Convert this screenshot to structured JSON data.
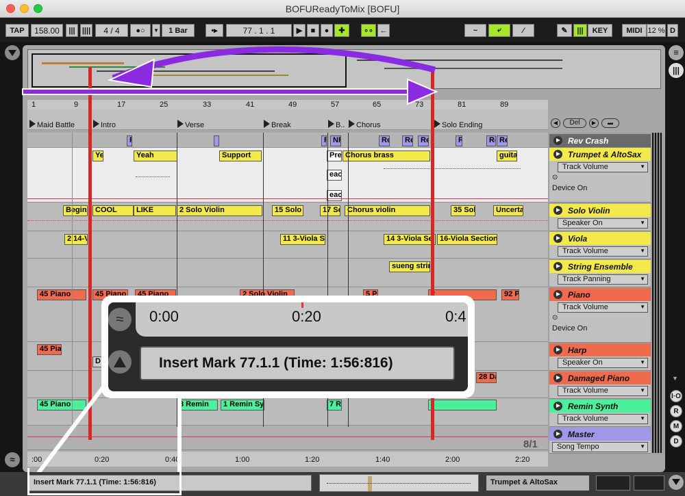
{
  "window": {
    "title": "BOFUReadyToMix  [BOFU]"
  },
  "control_bar": {
    "tap": "TAP",
    "tempo": "158.00",
    "signature": "4 / 4",
    "quantize": "1 Bar",
    "position": "77 .   1 .   1",
    "key": "KEY",
    "midi": "MIDI",
    "cpu": "12 %",
    "d": "D"
  },
  "ruler": {
    "bars": [
      "1",
      "9",
      "17",
      "25",
      "33",
      "41",
      "49",
      "57",
      "65",
      "73",
      "81",
      "89"
    ]
  },
  "locators": [
    "Maid Battle",
    "Intro",
    "Verse",
    "Break",
    "B..",
    "Chorus",
    "Solo Ending"
  ],
  "locator_controls": {
    "del": "Del"
  },
  "clips": {
    "rev": [
      "R",
      "R",
      "NR",
      "Re",
      "Re",
      "Re",
      "R",
      "Re",
      "Re"
    ],
    "lyrics": [
      "Ye",
      "Yeah",
      "Support",
      "Pre",
      "Chorus brass",
      "guita",
      "eact",
      "eact"
    ],
    "solo_violin": [
      "Begin",
      "COOL",
      "LIKE",
      "2 Solo Violin",
      "15 Solo",
      "17 So",
      "Chorus violin",
      "35 Sol",
      "Uncerta"
    ],
    "viola": [
      "2 14-V",
      "11 3-Viola Sc",
      "14 3-Viola Se",
      "16-Viola Section"
    ],
    "string": [
      "sueng strin"
    ],
    "piano": [
      "45 Piano",
      "45 Piano",
      "45 Piano",
      "2 Solo Violin",
      "5 P",
      "2",
      "92 P"
    ],
    "harp": [
      "45 Pia",
      "D",
      "28 Da"
    ],
    "remin": [
      "45 Piano",
      "8 Remin",
      "1 Remin Sy",
      "7 R"
    ]
  },
  "tracks": [
    {
      "name": "Rev Crash",
      "color": "#6a6a6a"
    },
    {
      "name": "Trumpet & AltoSax",
      "color": "#f3e94a",
      "param": "Track Volume",
      "device": "Device On"
    },
    {
      "name": "Solo Violin",
      "color": "#f3e94a",
      "param": "Speaker On"
    },
    {
      "name": "Viola",
      "color": "#f3e94a",
      "param": "Track Volume"
    },
    {
      "name": "String Ensemble",
      "color": "#f3e94a",
      "param": "Track Panning"
    },
    {
      "name": "Piano",
      "color": "#f06a4e",
      "param": "Track Volume",
      "device": "Device On"
    },
    {
      "name": "Harp",
      "color": "#f06a4e",
      "param": "Speaker On"
    },
    {
      "name": "Damaged Piano",
      "color": "#f06a4e",
      "param": "Track Volume"
    },
    {
      "name": "Remin Synth",
      "color": "#4cf09a",
      "param": "Track Volume"
    },
    {
      "name": "Master",
      "color": "#9f98e8",
      "param": "Song Tempo"
    }
  ],
  "time_ruler": [
    "0:20",
    "0:40",
    "1:00",
    "1:20",
    "1:40",
    "2:00",
    "2:20"
  ],
  "time_ruler_start": ":00",
  "zoom": "8/1",
  "callout": {
    "times": [
      "0:00",
      "0:20",
      "0:4"
    ],
    "message": "Insert Mark 77.1.1 (Time: 1:56:816)"
  },
  "status": {
    "message": "Insert Mark 77.1.1 (Time: 1:56:816)",
    "track": "Trumpet & AltoSax"
  },
  "side_buttons": [
    "I·O",
    "R",
    "M",
    "D"
  ]
}
